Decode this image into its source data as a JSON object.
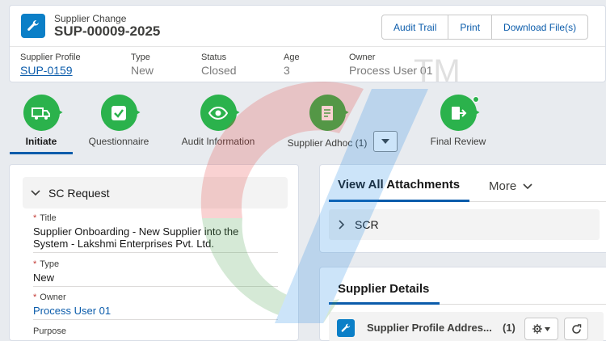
{
  "header": {
    "object_label": "Supplier Change",
    "record_name": "SUP-00009-2025",
    "icon": "wrench-icon",
    "buttons": [
      "Audit Trail",
      "Print",
      "Download File(s)"
    ],
    "fields": [
      {
        "label": "Supplier Profile",
        "value": "SUP-0159"
      },
      {
        "label": "Type",
        "value": "New"
      },
      {
        "label": "Status",
        "value": "Closed"
      },
      {
        "label": "Age",
        "value": "3"
      },
      {
        "label": "Owner",
        "value": "Process User 01"
      }
    ]
  },
  "watermark_text": "TM",
  "path": {
    "steps": [
      {
        "label": "Initiate",
        "icon": "truck-icon",
        "active": true
      },
      {
        "label": "Questionnaire",
        "icon": "checkbox-icon"
      },
      {
        "label": "Audit Information",
        "icon": "eye-icon"
      },
      {
        "label": "Supplier Adhoc (1)",
        "icon": "document-icon"
      },
      {
        "label": "Final Review",
        "icon": "exit-icon"
      }
    ]
  },
  "sc_request": {
    "section_title": "SC Request",
    "fields": [
      {
        "label": "Title",
        "required": true,
        "value_line1": "Supplier Onboarding - New Supplier into the",
        "value_line2": "System - Lakshmi Enterprises Pvt. Ltd."
      },
      {
        "label": "Type",
        "required": true,
        "value": "New"
      },
      {
        "label": "Owner",
        "required": true,
        "value": "Process User 01"
      },
      {
        "label": "Purpose",
        "required": false
      }
    ]
  },
  "attachments": {
    "tab_active": "View All Attachments",
    "tab_more": "More",
    "row": "SCR"
  },
  "supplier_details": {
    "title": "Supplier Details",
    "related_title": "Supplier Profile Addres...",
    "related_count": "(1)"
  },
  "colors": {
    "brand_blue": "#0b5cab",
    "icon_blue": "#0b7fc7",
    "path_green": "#2bb24c",
    "required_red": "#c23934"
  }
}
